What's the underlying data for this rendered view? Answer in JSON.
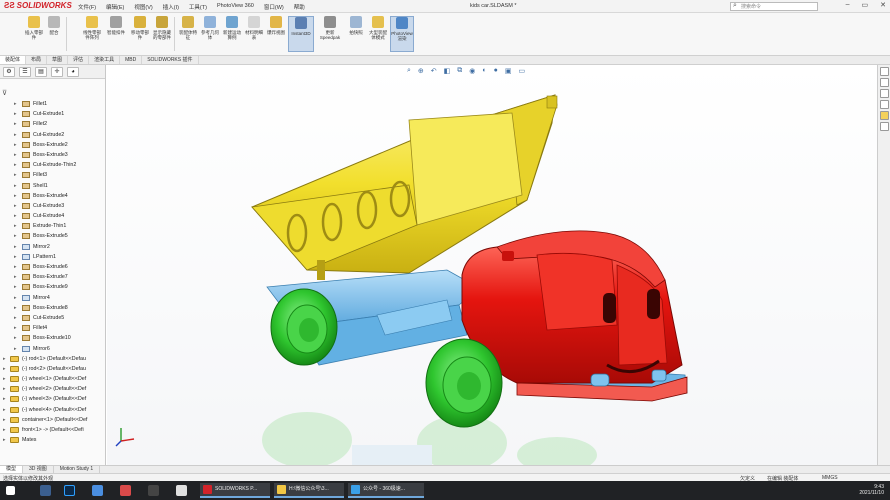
{
  "app": {
    "logo_text": "SOLIDWORKS",
    "document_title": "kids car.SLDASM *",
    "search_placeholder": "搜索命令",
    "menu": [
      "文件(F)",
      "编辑(E)",
      "视图(V)",
      "插入(I)",
      "工具(T)",
      "PhotoView 360",
      "窗口(W)",
      "帮助"
    ]
  },
  "ribbon": {
    "buttons": [
      {
        "label": "插入零部件"
      },
      {
        "label": "配合"
      },
      {
        "label": "线性零部件阵列"
      },
      {
        "label": "智能扣件"
      },
      {
        "label": "移动零部件"
      },
      {
        "label": "显示隐藏的零部件"
      },
      {
        "label": "装配体特征"
      },
      {
        "label": "参考几何体"
      },
      {
        "label": "新建运动算例"
      },
      {
        "label": "材料明细表"
      },
      {
        "label": "爆炸视图"
      },
      {
        "label": "Instant3D"
      },
      {
        "label": "更新 Speedpak"
      },
      {
        "label": "拍快照"
      },
      {
        "label": "大型装配体模式"
      },
      {
        "label": "PhotoView 渲染"
      }
    ]
  },
  "tabs": [
    "装配体",
    "布局",
    "草图",
    "评估",
    "渲染工具",
    "MBD",
    "SOLIDWORKS 插件"
  ],
  "feature_tree": {
    "features": [
      {
        "label": "Fillet1",
        "type": "feature"
      },
      {
        "label": "Cut-Extrude1",
        "type": "feature"
      },
      {
        "label": "Fillet2",
        "type": "feature"
      },
      {
        "label": "Cut-Extrude2",
        "type": "feature"
      },
      {
        "label": "Boss-Extrude2",
        "type": "feature"
      },
      {
        "label": "Boss-Extrude3",
        "type": "feature"
      },
      {
        "label": "Cut-Extrude-Thin2",
        "type": "feature"
      },
      {
        "label": "Fillet3",
        "type": "feature"
      },
      {
        "label": "Shell1",
        "type": "feature"
      },
      {
        "label": "Boss-Extrude4",
        "type": "feature"
      },
      {
        "label": "Cut-Extrude3",
        "type": "feature"
      },
      {
        "label": "Cut-Extrude4",
        "type": "feature"
      },
      {
        "label": "Extrude-Thin1",
        "type": "feature"
      },
      {
        "label": "Boss-Extrude5",
        "type": "feature"
      },
      {
        "label": "Mirror2",
        "type": "feature"
      },
      {
        "label": "LPattern1",
        "type": "feature"
      },
      {
        "label": "Boss-Extrude6",
        "type": "feature"
      },
      {
        "label": "Boss-Extrude7",
        "type": "feature"
      },
      {
        "label": "Boss-Extrude9",
        "type": "feature"
      },
      {
        "label": "Mirror4",
        "type": "feature"
      },
      {
        "label": "Boss-Extrude8",
        "type": "feature"
      },
      {
        "label": "Cut-Extrude5",
        "type": "feature"
      },
      {
        "label": "Fillet4",
        "type": "feature"
      },
      {
        "label": "Boss-Extrude10",
        "type": "feature"
      },
      {
        "label": "Mirror6",
        "type": "feature"
      }
    ],
    "components": [
      {
        "label": "(-) rod<1> (Default<<Defau"
      },
      {
        "label": "(-) rod<2> (Default<<Defau"
      },
      {
        "label": "(-) wheel<1> (Default<<Def"
      },
      {
        "label": "(-) wheel<2> (Default<<Def"
      },
      {
        "label": "(-) wheel<3> (Default<<Def"
      },
      {
        "label": "(-) wheel<4> (Default<<Def"
      },
      {
        "label": "container<1> (Default<<Def"
      },
      {
        "label": "front<1> -> (Default<<Defi"
      },
      {
        "label": "Mates"
      }
    ]
  },
  "bottom_tabs": [
    "模型",
    "3D 视图",
    "Motion Study 1"
  ],
  "status": {
    "left": "选择实体以修改其外观",
    "right": [
      "欠定义",
      "在编辑 装配体"
    ],
    "units": "MMGS"
  },
  "taskbar": {
    "apps": [
      {
        "label": "SOLIDWORKS P..."
      },
      {
        "label": "H:\\微信公众号\\3..."
      },
      {
        "label": "公众号 - 360极速..."
      }
    ],
    "time": "9:43",
    "date": "2021/11/10"
  },
  "colors": {
    "truck_bed": "#f2e030",
    "cab": "#e01a14",
    "wheels": "#3fcf3f",
    "chassis": "#7ec4f0",
    "accent": "#3f6ea3"
  }
}
